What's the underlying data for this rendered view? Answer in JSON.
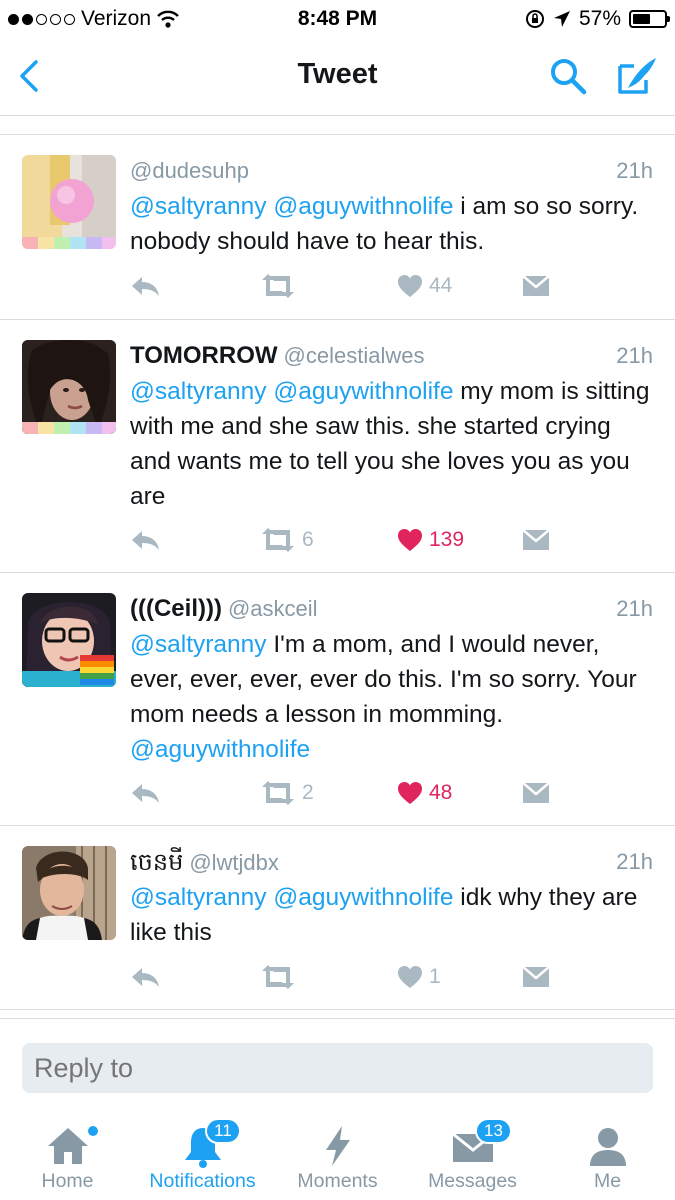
{
  "status_bar": {
    "carrier": "Verizon",
    "time": "8:48 PM",
    "battery": "57%",
    "battery_level": 0.57,
    "signal_bars_filled": 2,
    "signal_bars_total": 5
  },
  "nav": {
    "title": "Tweet",
    "icons": [
      "back-chevron-icon",
      "search-icon",
      "compose-icon"
    ],
    "accent_color": "#1da1f2"
  },
  "tweets": [
    {
      "display_name": "",
      "handle": "@dudesuhp",
      "time": "21h",
      "mentions": "@saltyranny @aguywithnolife",
      "text": " i am so so sorry. nobody should have to hear this.",
      "tail_mention": "",
      "retweets": "",
      "likes": "44",
      "liked": false
    },
    {
      "display_name": "TOMORROW",
      "handle": "@celestialwes",
      "time": "21h",
      "mentions": "@saltyranny @aguywithnolife",
      "text": " my mom is sitting with me and she saw this. she started crying and wants me to tell you she loves you as you are",
      "tail_mention": "",
      "retweets": "6",
      "likes": "139",
      "liked": true
    },
    {
      "display_name": "(((Ceil)))",
      "handle": "@askceil",
      "time": "21h",
      "mentions": "@saltyranny",
      "text": " I'm a mom, and I would never, ever, ever, ever, ever do this. I'm so sorry. Your mom needs a lesson in momming. ",
      "tail_mention": "@aguywithnolife",
      "retweets": "2",
      "likes": "48",
      "liked": true
    },
    {
      "display_name": "ចេនមី",
      "handle": "@lwtjdbx",
      "time": "21h",
      "mentions": "@saltyranny @aguywithnolife",
      "text": " idk why they are like this",
      "tail_mention": "",
      "retweets": "",
      "likes": "1",
      "liked": false
    }
  ],
  "reply": {
    "placeholder": "Reply to"
  },
  "tabs": [
    {
      "label": "Home",
      "icon": "home-icon",
      "active": false,
      "badge": ""
    },
    {
      "label": "Notifications",
      "icon": "bell-icon",
      "active": true,
      "badge": "11"
    },
    {
      "label": "Moments",
      "icon": "lightning-icon",
      "active": false,
      "badge": ""
    },
    {
      "label": "Messages",
      "icon": "envelope-icon",
      "active": false,
      "badge": "13"
    },
    {
      "label": "Me",
      "icon": "person-icon",
      "active": false,
      "badge": ""
    }
  ],
  "colors": {
    "link": "#1da1f2",
    "muted": "#8899a6",
    "like": "#e0245e",
    "action_gray": "#aab8c2"
  }
}
